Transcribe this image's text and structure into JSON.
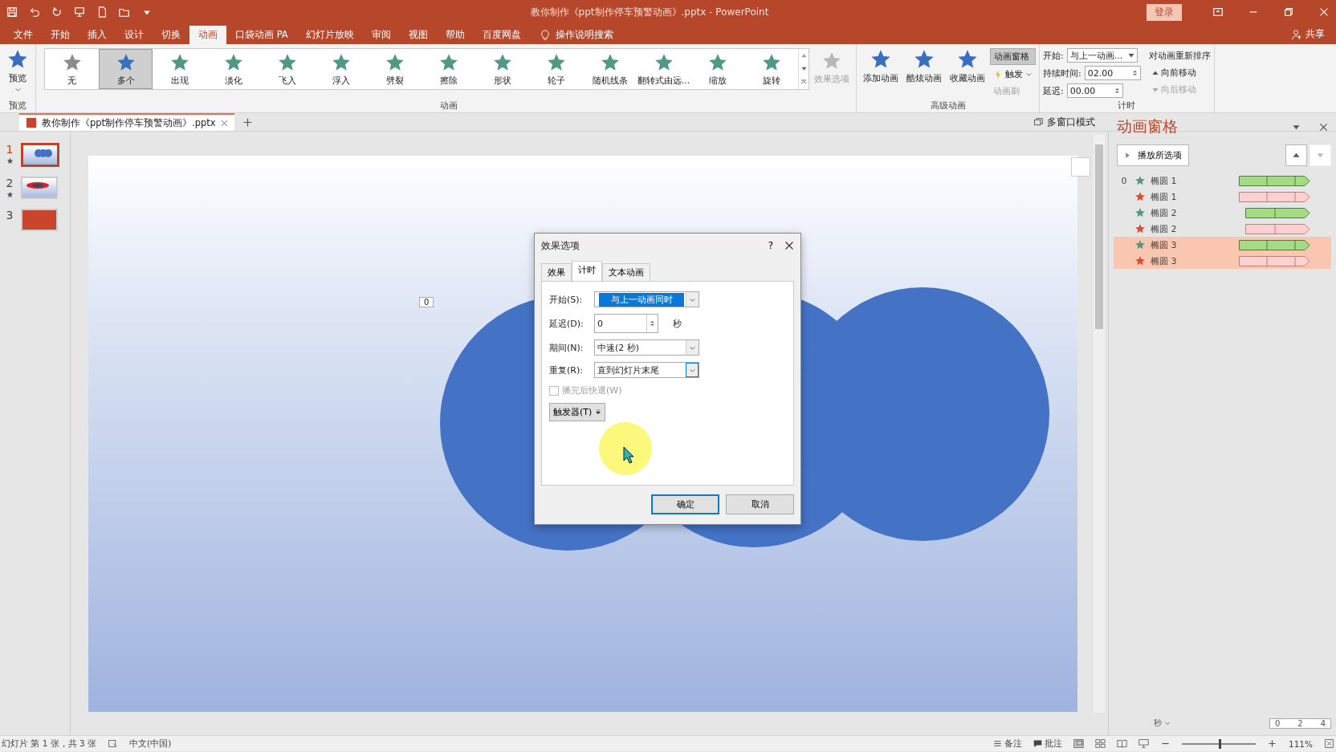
{
  "window": {
    "title": "教你制作《ppt制作停车预警动画》.pptx  -  PowerPoint",
    "login": "登录",
    "share": "共享"
  },
  "menu_tabs": [
    {
      "label": "文件",
      "selected": false
    },
    {
      "label": "开始",
      "selected": false
    },
    {
      "label": "插入",
      "selected": false
    },
    {
      "label": "设计",
      "selected": false
    },
    {
      "label": "切换",
      "selected": false
    },
    {
      "label": "动画",
      "selected": true
    },
    {
      "label": "口袋动画 PA",
      "selected": false
    },
    {
      "label": "幻灯片放映",
      "selected": false
    },
    {
      "label": "审阅",
      "selected": false
    },
    {
      "label": "视图",
      "selected": false
    },
    {
      "label": "帮助",
      "selected": false
    },
    {
      "label": "百度网盘",
      "selected": false
    }
  ],
  "tell_me": "操作说明搜索",
  "ribbon": {
    "preview": {
      "button": "预览",
      "group": "预览"
    },
    "gallery": [
      {
        "label": "无",
        "kind": "none",
        "selected": false
      },
      {
        "label": "多个",
        "kind": "multiple",
        "selected": true
      },
      {
        "label": "出现",
        "kind": "entrance",
        "selected": false
      },
      {
        "label": "淡化",
        "kind": "entrance",
        "selected": false
      },
      {
        "label": "飞入",
        "kind": "entrance",
        "selected": false
      },
      {
        "label": "浮入",
        "kind": "entrance",
        "selected": false
      },
      {
        "label": "劈裂",
        "kind": "entrance",
        "selected": false
      },
      {
        "label": "擦除",
        "kind": "entrance",
        "selected": false
      },
      {
        "label": "形状",
        "kind": "entrance",
        "selected": false
      },
      {
        "label": "轮子",
        "kind": "entrance",
        "selected": false
      },
      {
        "label": "随机线条",
        "kind": "entrance",
        "selected": false
      },
      {
        "label": "翻转式由远...",
        "kind": "entrance",
        "selected": false
      },
      {
        "label": "缩放",
        "kind": "entrance",
        "selected": false
      },
      {
        "label": "旋转",
        "kind": "entrance",
        "selected": false
      }
    ],
    "effect_options": {
      "label": "效果选项",
      "disabled": true
    },
    "animation_group": "动画",
    "advanced": {
      "add": "添加动画",
      "cool": "酷炫动画",
      "favorite": "收藏动画",
      "pane": {
        "label": "动画窗格",
        "selected": true
      },
      "trigger": "触发",
      "painter": {
        "label": "动画刷",
        "disabled": true
      },
      "group": "高级动画"
    },
    "timing": {
      "start_label": "开始:",
      "start_value": "与上一动画...",
      "duration_label": "持续时间:",
      "duration_value": "02.00",
      "delay_label": "延迟:",
      "delay_value": "00.00",
      "reorder": "对动画重新排序",
      "earlier": {
        "label": "向前移动",
        "disabled": false
      },
      "later": {
        "label": "向后移动",
        "disabled": true
      },
      "group": "计时"
    }
  },
  "doc_tab": {
    "title": "教你制作《ppt制作停车预警动画》.pptx",
    "multi_window": "多窗口模式"
  },
  "slides": [
    {
      "number": "1",
      "selected": true,
      "animated": true,
      "kind": "circles"
    },
    {
      "number": "2",
      "selected": false,
      "animated": true,
      "kind": "car"
    },
    {
      "number": "3",
      "selected": false,
      "animated": false,
      "kind": "title"
    }
  ],
  "slide": {
    "tag": "0"
  },
  "dialog": {
    "title": "效果选项",
    "help": "?",
    "tabs": [
      {
        "label": "效果",
        "selected": false
      },
      {
        "label": "计时",
        "selected": true
      },
      {
        "label": "文本动画",
        "selected": false
      }
    ],
    "start": {
      "label": "开始(S):",
      "value": "与上一动画同时"
    },
    "delay": {
      "label": "延迟(D):",
      "value": "0",
      "unit": "秒"
    },
    "period": {
      "label": "期间(N):",
      "value": "中速(2 秒)"
    },
    "repeat": {
      "label": "重复(R):",
      "value": "直到幻灯片末尾"
    },
    "rewind": {
      "label": "播完后快退(W)",
      "checked": false,
      "disabled": true
    },
    "trigger": "触发器(T)",
    "ok": "确定",
    "cancel": "取消"
  },
  "animation_pane": {
    "title": "动画窗格",
    "play": "播放所选项",
    "items": [
      {
        "index": "0",
        "name": "椭圆 1",
        "kind": "entrance",
        "delayed": false,
        "selected": false
      },
      {
        "name": "椭圆 1",
        "kind": "exit",
        "delayed": false,
        "selected": false
      },
      {
        "name": "椭圆 2",
        "kind": "entrance",
        "delayed": true,
        "selected": false
      },
      {
        "name": "椭圆 2",
        "kind": "exit",
        "delayed": true,
        "selected": false
      },
      {
        "name": "椭圆 3",
        "kind": "entrance",
        "delayed": false,
        "selected": true
      },
      {
        "name": "椭圆 3",
        "kind": "exit",
        "delayed": false,
        "selected": true
      }
    ],
    "unit": "秒",
    "ticks": [
      "0",
      "2",
      "4"
    ]
  },
  "status_bar": {
    "slide": "幻灯片 第 1 张，共 3 张",
    "language": "中文(中国)",
    "notes": "备注",
    "comments": "批注",
    "zoom": "111%",
    "zoom_slider": {
      "level": 0.5
    }
  }
}
